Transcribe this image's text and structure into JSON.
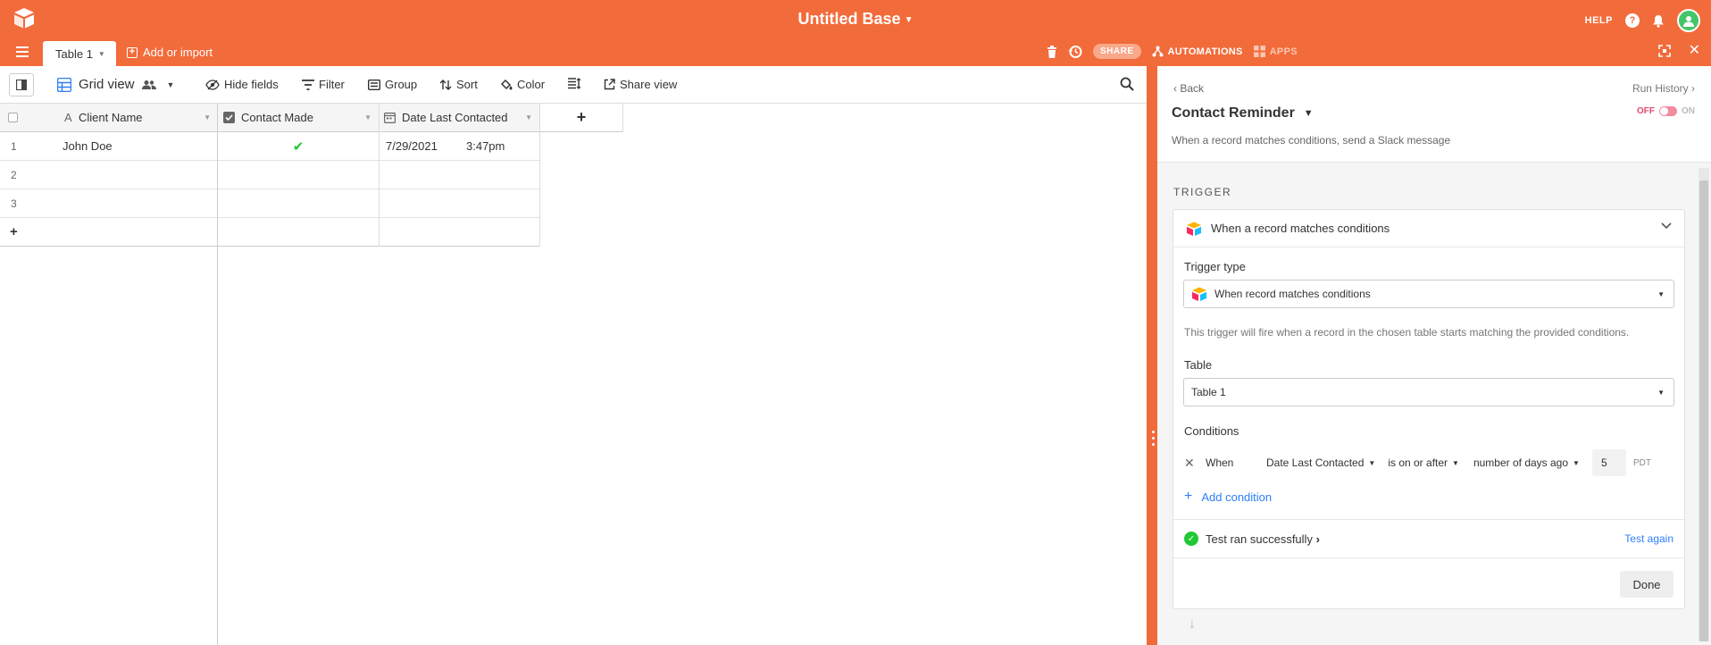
{
  "topbar": {
    "base_title": "Untitled Base",
    "help_label": "HELP"
  },
  "tabbar": {
    "active_tab": "Table 1",
    "add_import": "Add or import",
    "share": "SHARE",
    "automations": "AUTOMATIONS",
    "apps": "APPS"
  },
  "toolbar": {
    "view_name": "Grid view",
    "hide_fields": "Hide fields",
    "filter": "Filter",
    "group": "Group",
    "sort": "Sort",
    "color": "Color",
    "share_view": "Share view"
  },
  "grid": {
    "columns": [
      "Client Name",
      "Contact Made",
      "Date Last Contacted"
    ],
    "add_column": "+",
    "rows": [
      {
        "num": "1",
        "client_name": "John Doe",
        "contact_made": true,
        "date": "7/29/2021",
        "time": "3:47pm"
      },
      {
        "num": "2",
        "client_name": "",
        "contact_made": false,
        "date": "",
        "time": ""
      },
      {
        "num": "3",
        "client_name": "",
        "contact_made": false,
        "date": "",
        "time": ""
      }
    ],
    "add_row": "+"
  },
  "automation": {
    "back": "Back",
    "run_history": "Run History",
    "title": "Contact Reminder",
    "toggle_off": "OFF",
    "toggle_on": "ON",
    "description": "When a record matches conditions, send a Slack message",
    "trigger_section": "TRIGGER",
    "trigger_card_title": "When a record matches conditions",
    "trigger_type_label": "Trigger type",
    "trigger_type_value": "When record matches conditions",
    "trigger_help": "This trigger will fire when a record in the chosen table starts matching the provided conditions.",
    "table_label": "Table",
    "table_value": "Table 1",
    "conditions_label": "Conditions",
    "condition": {
      "when": "When",
      "field": "Date Last Contacted",
      "operator": "is on or after",
      "mode": "number of days ago",
      "value": "5",
      "timezone": "PDT"
    },
    "add_condition": "Add condition",
    "test_status": "Test ran successfully",
    "test_again": "Test again",
    "done": "Done"
  },
  "colors": {
    "brand": "#f26b3a",
    "link": "#2d7ff9",
    "success": "#20c933",
    "toggle_off": "#e04a6b"
  }
}
